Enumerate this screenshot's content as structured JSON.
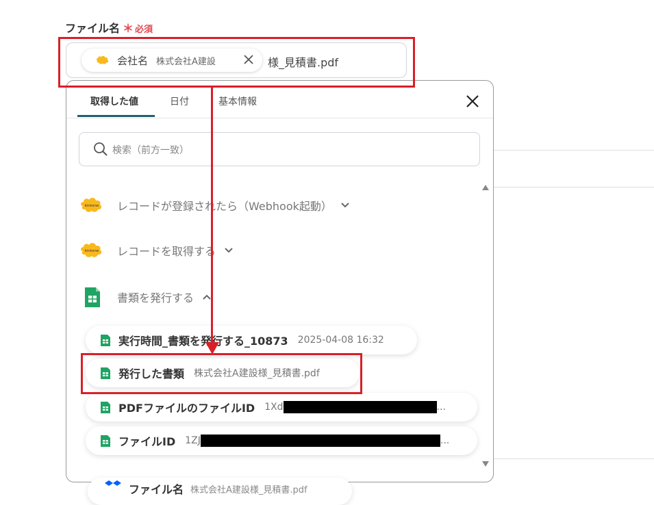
{
  "field": {
    "label": "ファイル名",
    "required_star": "＊",
    "required_text": "必須",
    "chip_name": "会社名",
    "chip_value": "株式会社A建設",
    "suffix": "様_見積書.pdf"
  },
  "panel": {
    "tabs": [
      {
        "label": "取得した値",
        "active": true
      },
      {
        "label": "日付",
        "active": false
      },
      {
        "label": "基本情報",
        "active": false
      }
    ],
    "search_placeholder": "検索（前方一致）",
    "groups": [
      {
        "label": "レコードが登録されたら（Webhook起動）",
        "icon": "kintone-icon",
        "expanded": false
      },
      {
        "label": "レコードを取得する",
        "icon": "kintone-icon",
        "expanded": false
      },
      {
        "label": "書類を発行する",
        "icon": "google-sheets-icon",
        "expanded": true
      }
    ],
    "items": [
      {
        "name": "実行時間_書類を発行する_10873",
        "value": "2025-04-08 16:32"
      },
      {
        "name": "発行した書類",
        "value": "株式会社A建設様_見積書.pdf"
      },
      {
        "name": "PDFファイルのファイルID",
        "value_prefix": "1Xd",
        "value_suffix": "..."
      },
      {
        "name": "ファイルID",
        "value_prefix": "1ZJ",
        "value_suffix": "..."
      }
    ]
  },
  "background_item": {
    "name": "ファイル名",
    "value": "株式会社A建設様_見積書.pdf"
  },
  "kintone_logo_text": "kintone",
  "colors": {
    "highlight_red": "#d91f28",
    "required_red": "#e5474e",
    "tab_underline": "#1f5f74",
    "kintone_yellow": "#f9b91d",
    "sheets_green": "#1fa463"
  }
}
